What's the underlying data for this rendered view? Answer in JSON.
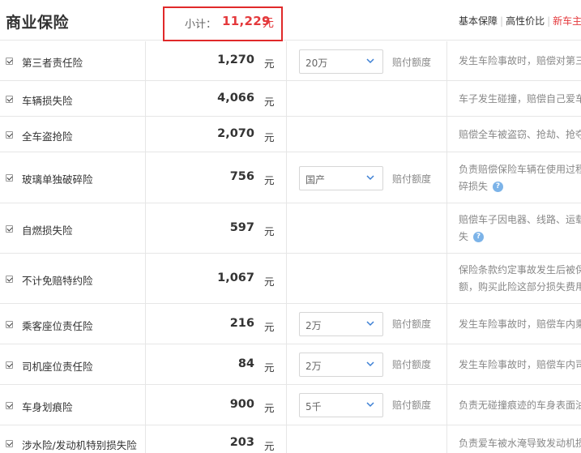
{
  "header": {
    "title": "商业保险",
    "subtotal_label": "小计：",
    "subtotal_value": "11,229",
    "subtotal_unit": "元",
    "tabs": [
      "基本保障",
      "高性价比",
      "新车主"
    ],
    "tab_separator": "|"
  },
  "labels": {
    "yuan": "元",
    "pay_limit": "赔付额度"
  },
  "colors": {
    "accent": "#e4393c",
    "highlight_border": "#e0292a",
    "help_icon": "#7cb3e8"
  },
  "rows": [
    {
      "checked": true,
      "name": "第三者责任险",
      "price": "1,270",
      "option": "20万",
      "desc": [
        "发生车险事故时，赔偿对第三"
      ]
    },
    {
      "checked": true,
      "name": "车辆损失险",
      "price": "4,066",
      "desc": [
        "车子发生碰撞，赔偿自己爱车"
      ]
    },
    {
      "checked": true,
      "name": "全车盗抢险",
      "price": "2,070",
      "desc": [
        "赔偿全车被盗窃、抢劫、抢夺"
      ]
    },
    {
      "checked": true,
      "name": "玻璃单独破碎险",
      "price": "756",
      "option": "国产",
      "desc": [
        "负责赔偿保险车辆在使用过程",
        "碎损失"
      ],
      "help": "?"
    },
    {
      "checked": true,
      "name": "自燃损失险",
      "price": "597",
      "desc": [
        "赔偿车子因电器、线路、运载",
        "失"
      ],
      "help": "?"
    },
    {
      "checked": true,
      "name": "不计免赔特约险",
      "price": "1,067",
      "desc": [
        "保险条款约定事故发生后被保",
        "额，购买此险这部分损失费用"
      ]
    },
    {
      "checked": true,
      "name": "乘客座位责任险",
      "price": "216",
      "option": "2万",
      "desc": [
        "发生车险事故时，赔偿车内乘"
      ]
    },
    {
      "checked": true,
      "name": "司机座位责任险",
      "price": "84",
      "option": "2万",
      "desc": [
        "发生车险事故时，赔偿车内司"
      ]
    },
    {
      "checked": true,
      "name": "车身划痕险",
      "price": "900",
      "option": "5千",
      "desc": [
        "负责无碰撞痕迹的车身表面油"
      ]
    },
    {
      "checked": true,
      "name": "涉水险/发动机特别损失险",
      "price": "203",
      "desc": [
        "负责爱车被水淹导致发动机损"
      ]
    }
  ]
}
